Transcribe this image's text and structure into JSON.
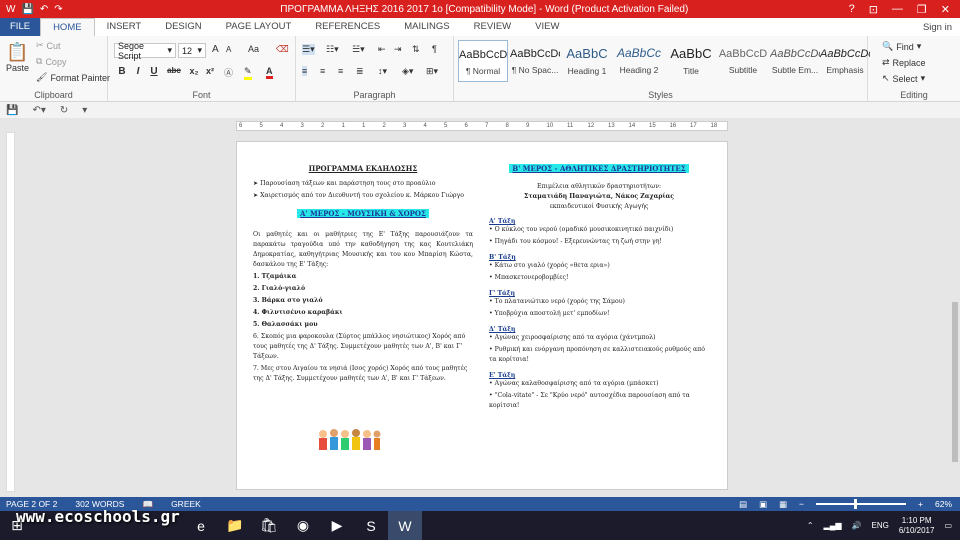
{
  "window": {
    "title": "ΠΡΟΓΡΑΜΜΑ ΛΗΞΗΣ 2016 2017 1ο [Compatibility Mode] - Word (Product Activation Failed)",
    "controls": [
      "?",
      "⊡",
      "—",
      "❐",
      "✕"
    ]
  },
  "tabs": [
    "FILE",
    "HOME",
    "INSERT",
    "DESIGN",
    "PAGE LAYOUT",
    "REFERENCES",
    "MAILINGS",
    "REVIEW",
    "VIEW"
  ],
  "signin": "Sign in",
  "clipboard": {
    "paste": "Paste",
    "cut": "Cut",
    "copy": "Copy",
    "format_painter": "Format Painter",
    "label": "Clipboard"
  },
  "font": {
    "name": "Segoe Script",
    "size": "12",
    "label": "Font",
    "grow": "A",
    "shrink": "A",
    "case": "Aa"
  },
  "format_buttons": [
    "B",
    "I",
    "U",
    "abc",
    "x₂",
    "x²"
  ],
  "paragraph": {
    "label": "Paragraph",
    "pilcrow": "¶"
  },
  "styles": {
    "label": "Styles",
    "items": [
      {
        "preview": "AaBbCcDc",
        "name": "¶ Normal"
      },
      {
        "preview": "AaBbCcDc",
        "name": "¶ No Spac..."
      },
      {
        "preview": "AaBbC",
        "name": "Heading 1"
      },
      {
        "preview": "AaBbCc",
        "name": "Heading 2"
      },
      {
        "preview": "AaBbC",
        "name": "Title"
      },
      {
        "preview": "AaBbCcD",
        "name": "Subtitle"
      },
      {
        "preview": "AaBbCcDc",
        "name": "Subtle Em..."
      },
      {
        "preview": "AaBbCcDc",
        "name": "Emphasis"
      }
    ]
  },
  "editing": {
    "find": "Find",
    "replace": "Replace",
    "select": "Select",
    "label": "Editing"
  },
  "ruler_ticks": [
    "6",
    "5",
    "4",
    "3",
    "2",
    "1",
    "1",
    "2",
    "3",
    "4",
    "5",
    "6",
    "7",
    "8",
    "9",
    "10",
    "11",
    "12",
    "13",
    "14",
    "15",
    "16",
    "17",
    "18"
  ],
  "doc": {
    "left": {
      "heading": "ΠΡΟΓΡΑΜΜΑ ΕΚΔΗΛΩΣΗΣ",
      "bullets": [
        "➤ Παρουσίαση τάξεων και παράστηση τους στο προαύλιο",
        "➤ Χαιρετισμός από τον Διευθυντή του σχολείου κ. Μάρκου Γιώργο"
      ],
      "part_a": "Α' ΜΕΡΟΣ - ΜΟΥΣΙΚΗ & ΧΟΡΟΣ",
      "intro": "Οι μαθητές και οι μαθήτριες της Ε' Τάξης παρουσιάζουν τα παρακάτω τραγούδια υπό την καθοδήγηση της κας Κουτελιάκη Δημοκρατίας, καθηγήτριας Μουσικής και του κου Μπαρίση Κώστα, δασκάλου της Ε' Τάξης:",
      "songs": [
        "1. Τζαμάικα",
        "2. Γιαλό-γιαλό",
        "3. Βάρκα στο γιαλό",
        "4. Φιλντισένιο καραβάκι",
        "5. Θαλασσάκι μου",
        "6. Σκοπός μια φαροκουλα (Σύρτος μπάλλος νησιώτικος) Χορός από τους μαθητές της Δ' Τάξης. Συμμετέχουν μαθητές των Α', Β' και Γ' Τάξεων.",
        "7. Μες στου Αιγαίου τα νησιά (Ισος χορός) Χορός από τους μαθητές της Δ' Τάξης. Συμμετέχουν μαθητές των Α', Β' και Γ' Τάξεων."
      ]
    },
    "right": {
      "part_b": "Β' ΜΕΡΟΣ - ΑΘΛΗΤΙΚΕΣ ΔΡΑΣΤΗΡΙΟΤΗΤΕΣ",
      "coord": [
        "Επιμέλεια αθλητικών δραστηριοτήτων:",
        "Σταματιάδη Παναγιώτα, Νάκος Ζαχαρίας",
        "εκπαιδευτικοί Φυσικής Αγωγής"
      ],
      "classes": [
        {
          "title": "Α' Τάξη",
          "items": [
            "Ο κύκλος του νερού (ομαδικό μουσικοκινητικό παιχνίδι)",
            "Πηγάδι του κόσμου! - Εξερευνώντας τη ζωή στην γη!"
          ]
        },
        {
          "title": "Β' Τάξη",
          "items": [
            "Κάτω στο γιαλό (χορός «θετα ερια»)",
            "Μπασκετονεροβομβίες!"
          ]
        },
        {
          "title": "Γ' Τάξη",
          "items": [
            "Το πλατανιώτικο νερό (χορός της Σάμου)",
            "Υποβρύχια αποστολή μετ' εμποδίων!"
          ]
        },
        {
          "title": "Δ' Τάξη",
          "items": [
            "Αγώνας χειροσφαίρισης από τα αγόρια (χάντμπολ)",
            "Ρυθμική και ενόργανη προπόνηση σε καλλιστειακούς ρυθμούς από τα κορίτσια!"
          ]
        },
        {
          "title": "Ε' Τάξη",
          "items": [
            "Αγώνας καλαθοσφαίρισης από τα αγόρια (μπάσκετ)",
            "\"Cola-vitate\" - Σε \"Κρύο νερό\" αυτοσχέδια παρουσίαση από τα κορίτσια!"
          ]
        }
      ]
    }
  },
  "status": {
    "page": "PAGE 2 OF 2",
    "words": "302 WORDS",
    "lang": "GREEK",
    "zoom": "62%"
  },
  "taskbar": {
    "watermark": "www.ecoschools.gr",
    "lang": "ENG",
    "time": "1:10 PM",
    "date": "6/10/2017"
  }
}
